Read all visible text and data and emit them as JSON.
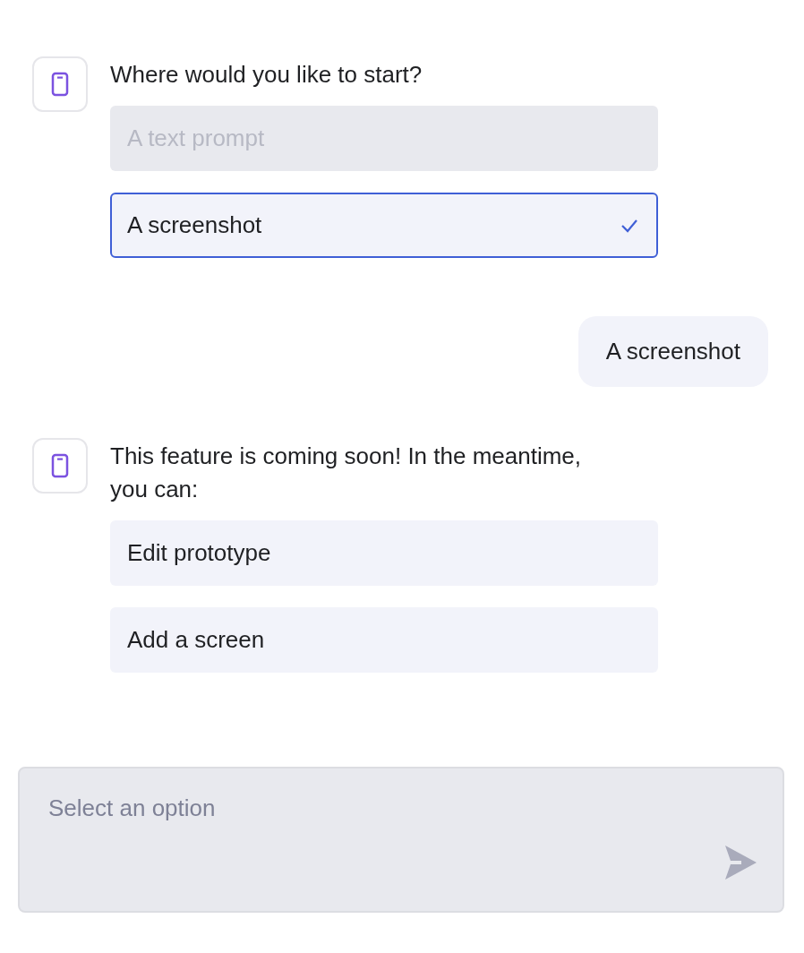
{
  "messages": [
    {
      "kind": "bot",
      "text": "Where would you like to start?",
      "options": [
        {
          "label": "A text prompt",
          "disabled": true,
          "selected": false
        },
        {
          "label": "A screenshot",
          "disabled": false,
          "selected": true
        }
      ]
    },
    {
      "kind": "user",
      "text": "A screenshot"
    },
    {
      "kind": "bot",
      "text": "This feature is coming soon! In the meantime, you can:",
      "options": [
        {
          "label": "Edit prototype",
          "disabled": false,
          "selected": false
        },
        {
          "label": "Add a screen",
          "disabled": false,
          "selected": false
        }
      ]
    }
  ],
  "composer": {
    "placeholder": "Select an option"
  }
}
